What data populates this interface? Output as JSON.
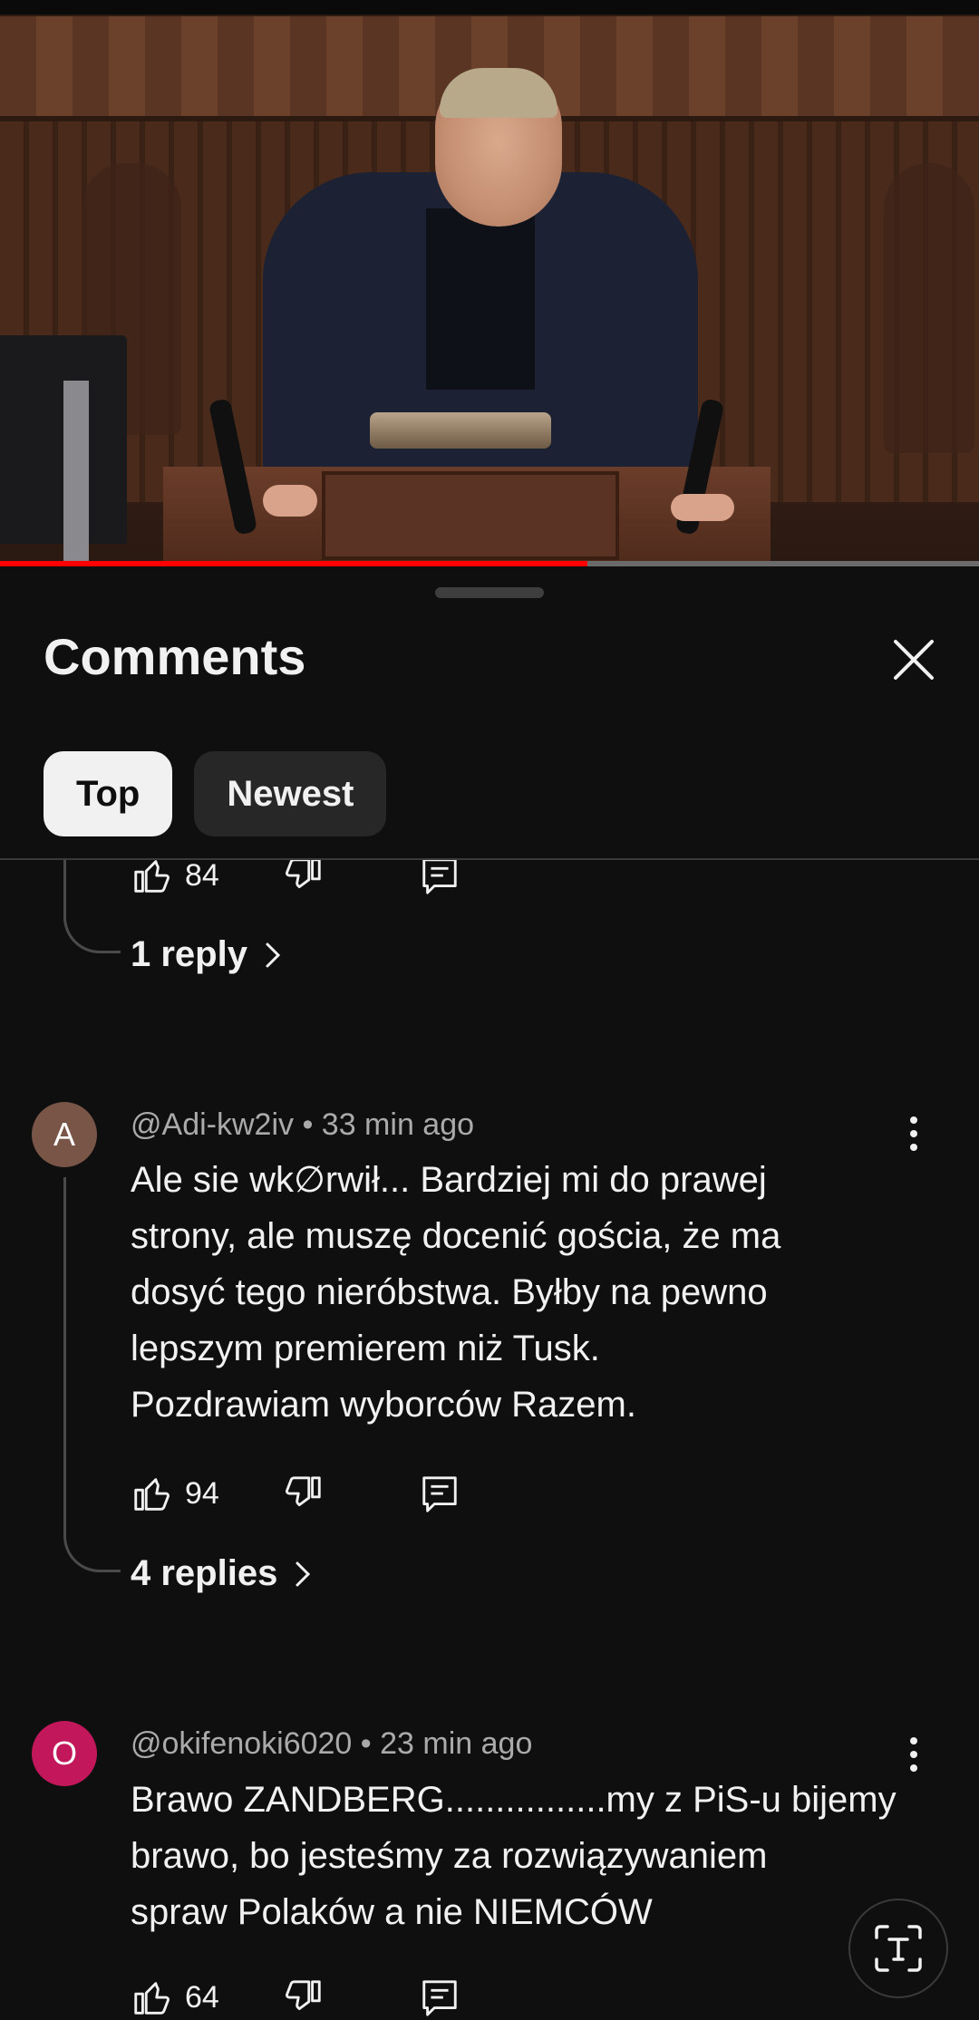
{
  "video": {
    "progress_fraction": 0.6
  },
  "sheet": {
    "title": "Comments",
    "sort_chips": [
      {
        "label": "Top",
        "selected": true
      },
      {
        "label": "Newest",
        "selected": false
      }
    ]
  },
  "comments": [
    {
      "partial": true,
      "likes": "84",
      "replies_label": "1 reply"
    },
    {
      "avatar_letter": "A",
      "avatar_color": "#795548",
      "author": "@Adi-kw2iv",
      "separator": " • ",
      "time": "33 min ago",
      "text": "Ale sie wk∅rwił...  Bardziej mi do prawej\nstrony, ale muszę docenić gościa, że ma\ndosyć tego nieróbstwa. Byłby na pewno\nlepszym premierem niż Tusk.\nPozdrawiam wyborców Razem.",
      "likes": "94",
      "replies_label": "4 replies"
    },
    {
      "avatar_letter": "O",
      "avatar_color": "#c2185b",
      "author": "@okifenoki6020",
      "separator": " • ",
      "time": "23 min ago",
      "text": "Brawo ZANDBERG................my z PiS-u bijemy\nbrawo, bo jesteśmy za rozwiązywaniem\nspraw Polaków a nie NIEMCÓW",
      "likes": "64"
    }
  ],
  "icons": {
    "close": "close-icon",
    "like": "thumb-up-icon",
    "dislike": "thumb-down-icon",
    "reply": "reply-comment-icon",
    "more": "more-vert-icon",
    "chevron": "chevron-right-icon",
    "text_select": "text-select-icon"
  }
}
